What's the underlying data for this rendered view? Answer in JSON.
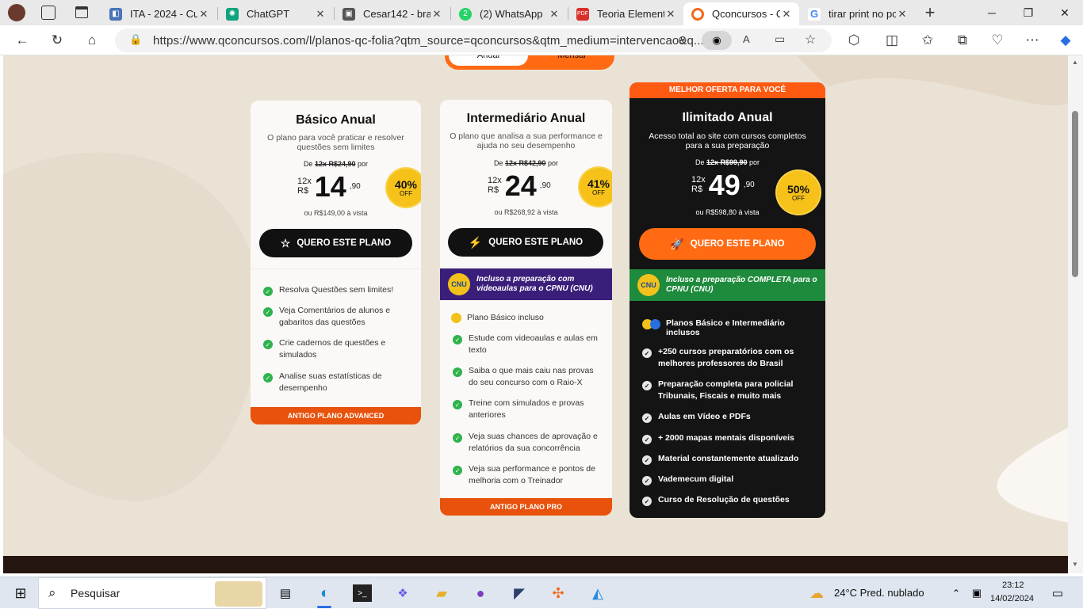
{
  "browser": {
    "tabs": [
      {
        "title": "ITA - 2024 - Cu",
        "icon": "edge-tab-icon",
        "color": "#4a76b8"
      },
      {
        "title": "ChatGPT",
        "icon": "chatgpt-icon",
        "color": "#10a37f"
      },
      {
        "title": "Cesar142 - brai",
        "icon": "brainly-icon",
        "color": "#555555"
      },
      {
        "title": "(2) WhatsApp",
        "icon": "whatsapp-icon",
        "color": "#25d366"
      },
      {
        "title": "Teoria Element",
        "icon": "pdf-icon",
        "color": "#d9302c"
      },
      {
        "title": "Qconcursos - C",
        "icon": "qconcursos-icon",
        "color": "#f26a1b"
      },
      {
        "title": "tirar print no pc",
        "icon": "google-icon",
        "color": "#4285f4"
      }
    ],
    "new_tab": "+",
    "url": "https://www.qconcursos.com/l/planos-qc-folia?qtm_source=qconcursos&qtm_medium=intervencao&q..."
  },
  "page": {
    "toggle": {
      "annual": "Anual",
      "monthly": "Mensal"
    },
    "plans": [
      {
        "title": "Básico Anual",
        "desc": "O plano para você praticar e resolver questões sem limites",
        "old_prefix": "De",
        "old_price": "12x R$24,90",
        "old_suffix": "por",
        "installments": "12x",
        "currency": "R$",
        "price": "14",
        "cents": ",90",
        "cash": "ou R$149,00 à vista",
        "discount": "40%",
        "off": "OFF",
        "cta": "QUERO ESTE PLANO",
        "features": [
          "Resolva Questões sem limites!",
          "Veja Comentários de alunos e gabaritos das questões",
          "Crie cadernos de questões e simulados",
          "Analise suas estatísticas de desempenho"
        ],
        "footer": "ANTIGO PLANO ADVANCED"
      },
      {
        "title": "Intermediário Anual",
        "desc": "O plano que analisa a sua performance e ajuda no seu desempenho",
        "old_prefix": "De",
        "old_price": "12x R$42,90",
        "old_suffix": "por",
        "installments": "12x",
        "currency": "R$",
        "price": "24",
        "cents": ",90",
        "cash": "ou R$268,92 à vista",
        "discount": "41%",
        "off": "OFF",
        "cta": "QUERO ESTE PLANO",
        "cnu_logo": "CNU",
        "cnu": "Incluso a preparação com videoaulas para o CPNU (CNU)",
        "included": "Plano Básico incluso",
        "features": [
          "Estude com videoaulas e aulas em texto",
          "Saiba o que mais caiu nas provas do seu concurso com o Raio-X",
          "Treine com simulados e provas anteriores",
          "Veja suas chances de aprovação e relatórios da sua concorrência",
          "Veja sua performance e pontos de melhoria com o Treinador"
        ],
        "footer": "ANTIGO PLANO PRO"
      },
      {
        "ribbon": "MELHOR OFERTA PARA VOCÊ",
        "title": "Ilimitado Anual",
        "desc": "Acesso total ao site com cursos completos para a sua preparação",
        "old_prefix": "De",
        "old_price": "12x R$99,90",
        "old_suffix": "por",
        "installments": "12x",
        "currency": "R$",
        "price": "49",
        "cents": ",90",
        "cash": "ou R$598,80 à vista",
        "discount": "50%",
        "off": "OFF",
        "cta": "QUERO ESTE PLANO",
        "cnu_logo": "CNU",
        "cnu": "Incluso a preparação COMPLETA para o CPNU (CNU)",
        "included": "Planos Básico e Intermediário inclusos",
        "features": [
          "+250 cursos preparatórios com os melhores professores do Brasil",
          "Preparação completa para policial Tribunais, Fiscais e muito mais",
          "Aulas em Vídeo e PDFs",
          "+ 2000 mapas mentais disponíveis",
          "Material constantemente atualizado",
          "Vademecum digital",
          "Curso de Resolução de questões"
        ]
      }
    ]
  },
  "taskbar": {
    "search": "Pesquisar",
    "weather": "24°C  Pred. nublado",
    "time": "23:12",
    "date": "14/02/2024"
  },
  "colors": {
    "orange": "#ff6a13",
    "dark": "#111111",
    "purple": "#3a1f7a",
    "green": "#1e8a3c"
  }
}
